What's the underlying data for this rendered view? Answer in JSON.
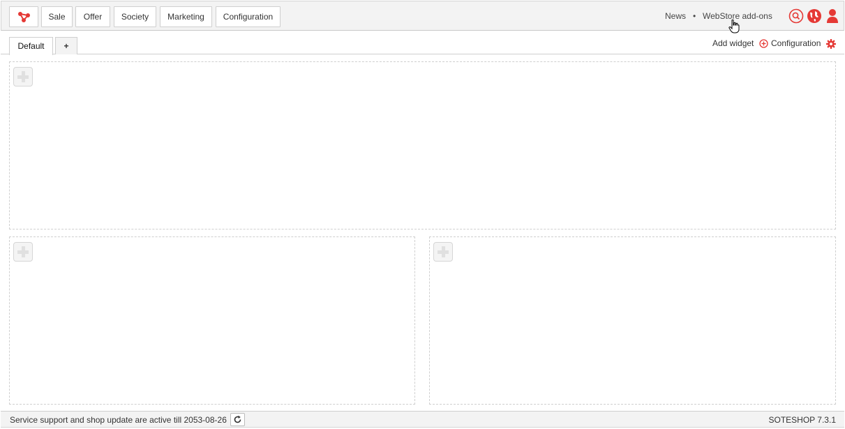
{
  "colors": {
    "accent": "#e53935",
    "border": "#cfcfcf",
    "bar_bg": "#f3f3f3"
  },
  "topbar": {
    "logo_icon": "share-nodes-logo",
    "nav": [
      {
        "label": "Sale"
      },
      {
        "label": "Offer"
      },
      {
        "label": "Society"
      },
      {
        "label": "Marketing"
      },
      {
        "label": "Configuration"
      }
    ],
    "links": {
      "news": "News",
      "separator": "•",
      "webstore": "WebStore add-ons"
    },
    "icons": [
      "search-icon",
      "globe-icon",
      "user-icon"
    ]
  },
  "tabs": {
    "active": "Default",
    "add": "+"
  },
  "actions": {
    "add_widget": "Add widget",
    "configuration": "Configuration"
  },
  "footer": {
    "support_text": "Service support and shop update are active till 2053-08-26",
    "version": "SOTESHOP 7.3.1"
  }
}
